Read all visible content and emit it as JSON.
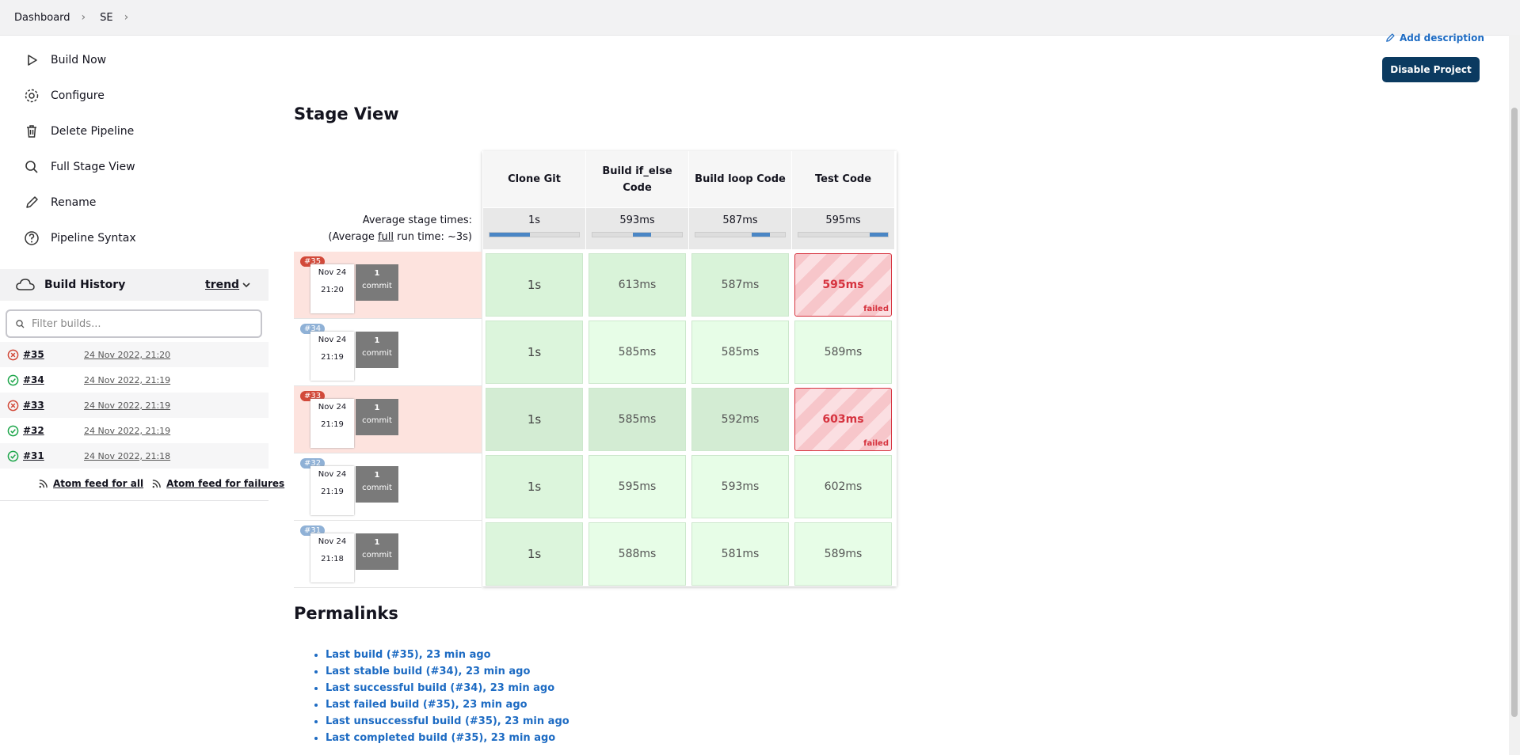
{
  "breadcrumb": {
    "items": [
      "Dashboard",
      "SE"
    ]
  },
  "sidebar": {
    "tasks": [
      {
        "label": "Build Now",
        "icon": "play-icon"
      },
      {
        "label": "Configure",
        "icon": "gear-icon"
      },
      {
        "label": "Delete Pipeline",
        "icon": "trash-icon"
      },
      {
        "label": "Full Stage View",
        "icon": "search-icon"
      },
      {
        "label": "Rename",
        "icon": "pencil-icon"
      },
      {
        "label": "Pipeline Syntax",
        "icon": "help-icon"
      }
    ]
  },
  "build_history": {
    "title": "Build History",
    "trend_label": "trend",
    "filter_placeholder": "Filter builds...",
    "builds": [
      {
        "number": "#35",
        "date": "24 Nov 2022, 21:20",
        "status": "failed"
      },
      {
        "number": "#34",
        "date": "24 Nov 2022, 21:19",
        "status": "success"
      },
      {
        "number": "#33",
        "date": "24 Nov 2022, 21:19",
        "status": "failed"
      },
      {
        "number": "#32",
        "date": "24 Nov 2022, 21:19",
        "status": "success"
      },
      {
        "number": "#31",
        "date": "24 Nov 2022, 21:18",
        "status": "success"
      }
    ],
    "feed_all": "Atom feed for all",
    "feed_failures": "Atom feed for failures"
  },
  "header": {
    "add_description": "Add description",
    "disable_project": "Disable Project"
  },
  "stage_view": {
    "title": "Stage View",
    "avg_label_1": "Average stage times:",
    "avg_label_2_prefix": "(Average ",
    "avg_label_2_full": "full",
    "avg_label_2_suffix": " run time: ~3s)",
    "stages": [
      "Clone Git",
      "Build if_else Code",
      "Build loop Code",
      "Test Code"
    ],
    "averages": [
      "1s",
      "593ms",
      "587ms",
      "595ms"
    ],
    "average_fill_fractions": [
      0.45,
      0.2,
      0.2,
      0.2
    ],
    "runs": [
      {
        "badge": "#35",
        "status": "failed",
        "date": "Nov 24",
        "time": "21:20",
        "commit_count": "1",
        "commit_word": "commit",
        "stages": [
          "1s",
          "613ms",
          "587ms",
          "595ms"
        ],
        "stage_status": [
          "ok",
          "ok",
          "ok",
          "failed"
        ]
      },
      {
        "badge": "#34",
        "status": "success",
        "date": "Nov 24",
        "time": "21:19",
        "commit_count": "1",
        "commit_word": "commit",
        "stages": [
          "1s",
          "585ms",
          "585ms",
          "589ms"
        ],
        "stage_status": [
          "ok",
          "ok",
          "ok",
          "ok"
        ]
      },
      {
        "badge": "#33",
        "status": "failed",
        "date": "Nov 24",
        "time": "21:19",
        "commit_count": "1",
        "commit_word": "commit",
        "stages": [
          "1s",
          "585ms",
          "592ms",
          "603ms"
        ],
        "stage_status": [
          "ok",
          "ok",
          "ok",
          "failed"
        ]
      },
      {
        "badge": "#32",
        "status": "success",
        "date": "Nov 24",
        "time": "21:19",
        "commit_count": "1",
        "commit_word": "commit",
        "stages": [
          "1s",
          "595ms",
          "593ms",
          "602ms"
        ],
        "stage_status": [
          "ok",
          "ok",
          "ok",
          "ok"
        ]
      },
      {
        "badge": "#31",
        "status": "success",
        "date": "Nov 24",
        "time": "21:18",
        "commit_count": "1",
        "commit_word": "commit",
        "stages": [
          "1s",
          "588ms",
          "581ms",
          "589ms"
        ],
        "stage_status": [
          "ok",
          "ok",
          "ok",
          "ok"
        ]
      }
    ],
    "failed_label": "failed"
  },
  "permalinks": {
    "title": "Permalinks",
    "links": [
      "Last build (#35), 23 min ago",
      "Last stable build (#34), 23 min ago",
      "Last successful build (#34), 23 min ago",
      "Last failed build (#35), 23 min ago",
      "Last unsuccessful build (#35), 23 min ago",
      "Last completed build (#35), 23 min ago"
    ]
  },
  "colors": {
    "failed_badge": "#d24939",
    "success_badge": "#8fb1d6",
    "failed_row": "#fbe1dc",
    "link": "#1d6bc3",
    "primary_button": "#0b3a60"
  }
}
